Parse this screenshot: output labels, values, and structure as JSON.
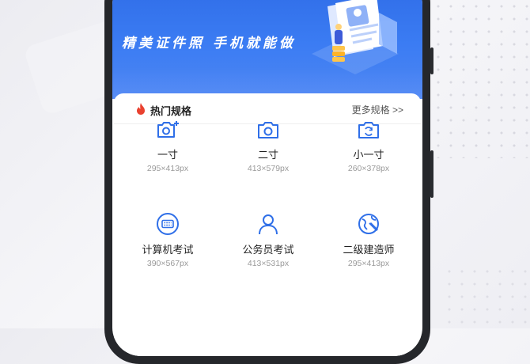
{
  "banner": {
    "slogan": "精美证件照 手机就能做"
  },
  "section": {
    "title": "热门规格",
    "more_link": "更多规格 >>"
  },
  "specs": [
    {
      "name": "一寸",
      "size": "295×413px",
      "icon": "camera-plus-icon"
    },
    {
      "name": "二寸",
      "size": "413×579px",
      "icon": "camera-icon"
    },
    {
      "name": "小一寸",
      "size": "260×378px",
      "icon": "camera-rotate-icon"
    },
    {
      "name": "计算机考试",
      "size": "390×567px",
      "icon": "keyboard-icon"
    },
    {
      "name": "公务员考试",
      "size": "413×531px",
      "icon": "person-icon"
    },
    {
      "name": "二级建造师",
      "size": "295×413px",
      "icon": "globe-icon"
    }
  ],
  "colors": {
    "accent": "#2e6be6",
    "icon_blue": "#2f6fe8",
    "hot_red": "#e9412f"
  }
}
